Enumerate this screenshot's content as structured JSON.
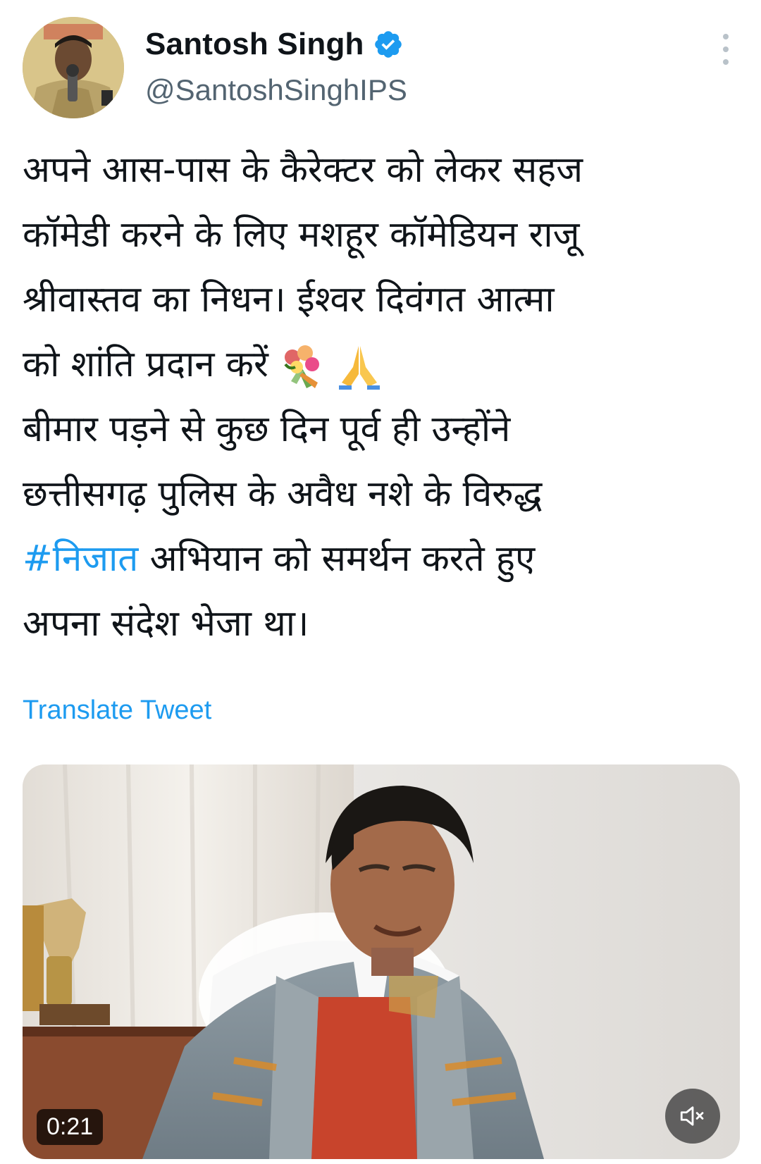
{
  "author": {
    "name": "Santosh Singh",
    "handle": "@SantoshSinghIPS",
    "verified": true
  },
  "tweet": {
    "lines": [
      "अपने आस-पास के कैरेक्टर को लेकर सहज",
      "कॉमेडी करने के लिए मशहूर कॉमेडियन राजू",
      "श्रीवास्तव का निधन। ईश्वर दिवंगत आत्मा",
      "को शांति प्रदान करें",
      "बीमार पड़ने से कुछ दिन पूर्व ही उन्होंने",
      "छत्तीसगढ़ पुलिस के अवैध नशे के विरुद्ध",
      "अभियान को समर्थन करते हुए",
      "अपना संदेश भेजा था।"
    ],
    "hashtag": "#निजात",
    "emojis": [
      "bouquet-icon",
      "folded-hands-icon"
    ],
    "translate_label": "Translate Tweet"
  },
  "video": {
    "duration": "0:21",
    "muted": true
  },
  "colors": {
    "link": "#1d9bf0",
    "text": "#0f1419",
    "secondary": "#536471"
  }
}
